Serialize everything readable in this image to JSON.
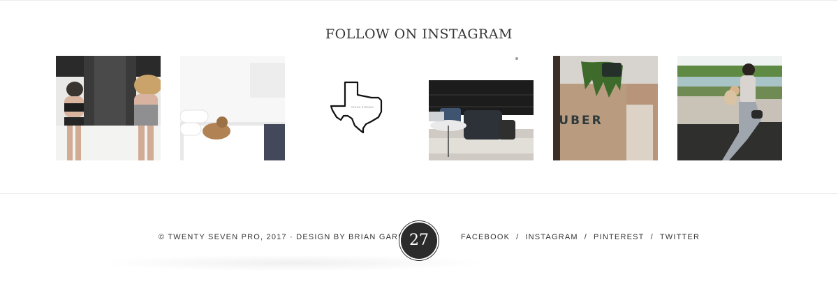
{
  "instagram": {
    "title": "FOLLOW ON INSTAGRAM",
    "texas_tile_caption": "TEXAS STRONG",
    "uber_sign": "UBER"
  },
  "footer": {
    "copyright": "© TWENTY SEVEN PRO, 2017 · DESIGN BY BRIAN GARDNER",
    "logo_text": "27",
    "social_links": [
      "FACEBOOK",
      "INSTAGRAM",
      "PINTEREST",
      "TWITTER"
    ],
    "separator": "/"
  },
  "colors": {
    "text": "#333333",
    "logo_badge": "#2b2b2b",
    "divider": "#ececec"
  }
}
